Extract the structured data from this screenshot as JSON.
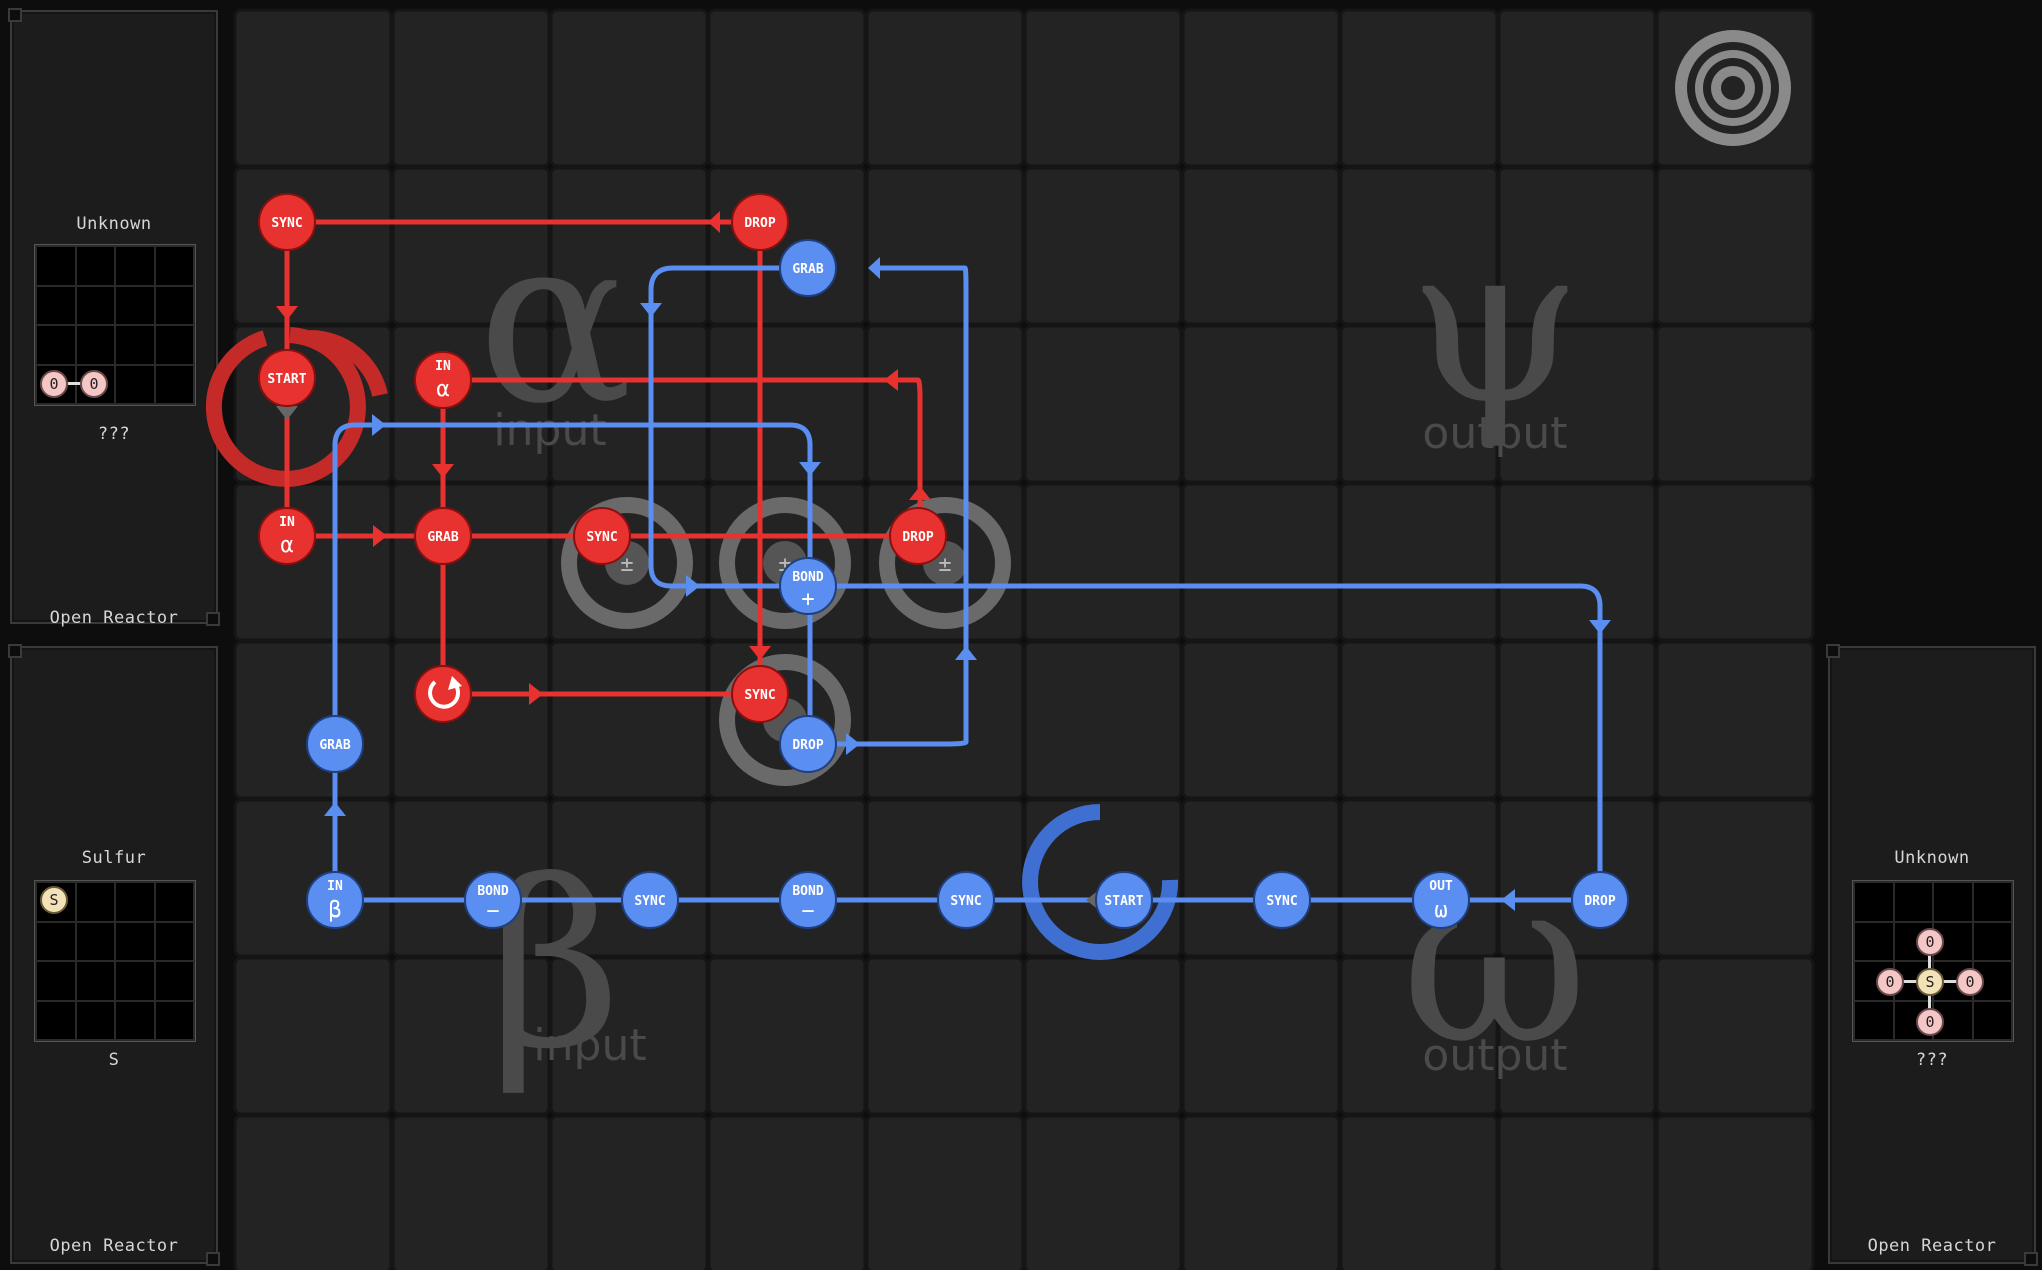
{
  "left_panels": [
    {
      "title": "Unknown",
      "formula": "???",
      "footer": "Open Reactor",
      "atoms": [
        {
          "symbol": "0",
          "type": "H"
        },
        {
          "symbol": "0",
          "type": "H"
        }
      ]
    },
    {
      "title": "Sulfur",
      "formula": "S",
      "footer": "Open Reactor",
      "atoms": [
        {
          "symbol": "S",
          "type": "S"
        }
      ]
    }
  ],
  "right_panel": {
    "title": "Unknown",
    "formula": "???",
    "footer": "Open Reactor",
    "atoms": [
      {
        "symbol": "0",
        "type": "H"
      },
      {
        "symbol": "0",
        "type": "H"
      },
      {
        "symbol": "S",
        "type": "S"
      },
      {
        "symbol": "0",
        "type": "H"
      },
      {
        "symbol": "0",
        "type": "H"
      }
    ]
  },
  "regions": {
    "alpha": {
      "symbol": "α",
      "label": "input"
    },
    "beta": {
      "symbol": "β",
      "label": "input"
    },
    "psi": {
      "symbol": "ψ",
      "label": "output"
    },
    "omega": {
      "symbol": "ω",
      "label": "output"
    }
  },
  "colors": {
    "red": "#e8322f",
    "blue": "#5a8ef0",
    "grid_bg": "#1e1e1e",
    "cell": "#232323"
  },
  "red_instructions": [
    {
      "label": "SYNC"
    },
    {
      "label": "DROP"
    },
    {
      "label": "START"
    },
    {
      "label": "IN",
      "sub": "α"
    },
    {
      "label": "IN",
      "sub": "α"
    },
    {
      "label": "GRAB"
    },
    {
      "label": "SYNC"
    },
    {
      "label": "DROP"
    },
    {
      "label": "rotate-icon"
    },
    {
      "label": "SYNC"
    }
  ],
  "blue_instructions": [
    {
      "label": "GRAB"
    },
    {
      "label": "BOND",
      "sub": "+"
    },
    {
      "label": "DROP"
    },
    {
      "label": "GRAB"
    },
    {
      "label": "IN",
      "sub": "β"
    },
    {
      "label": "BOND",
      "sub": "−"
    },
    {
      "label": "SYNC"
    },
    {
      "label": "BOND",
      "sub": "−"
    },
    {
      "label": "SYNC"
    },
    {
      "label": "START"
    },
    {
      "label": "SYNC"
    },
    {
      "label": "OUT",
      "sub": "ω"
    },
    {
      "label": "DROP"
    }
  ]
}
